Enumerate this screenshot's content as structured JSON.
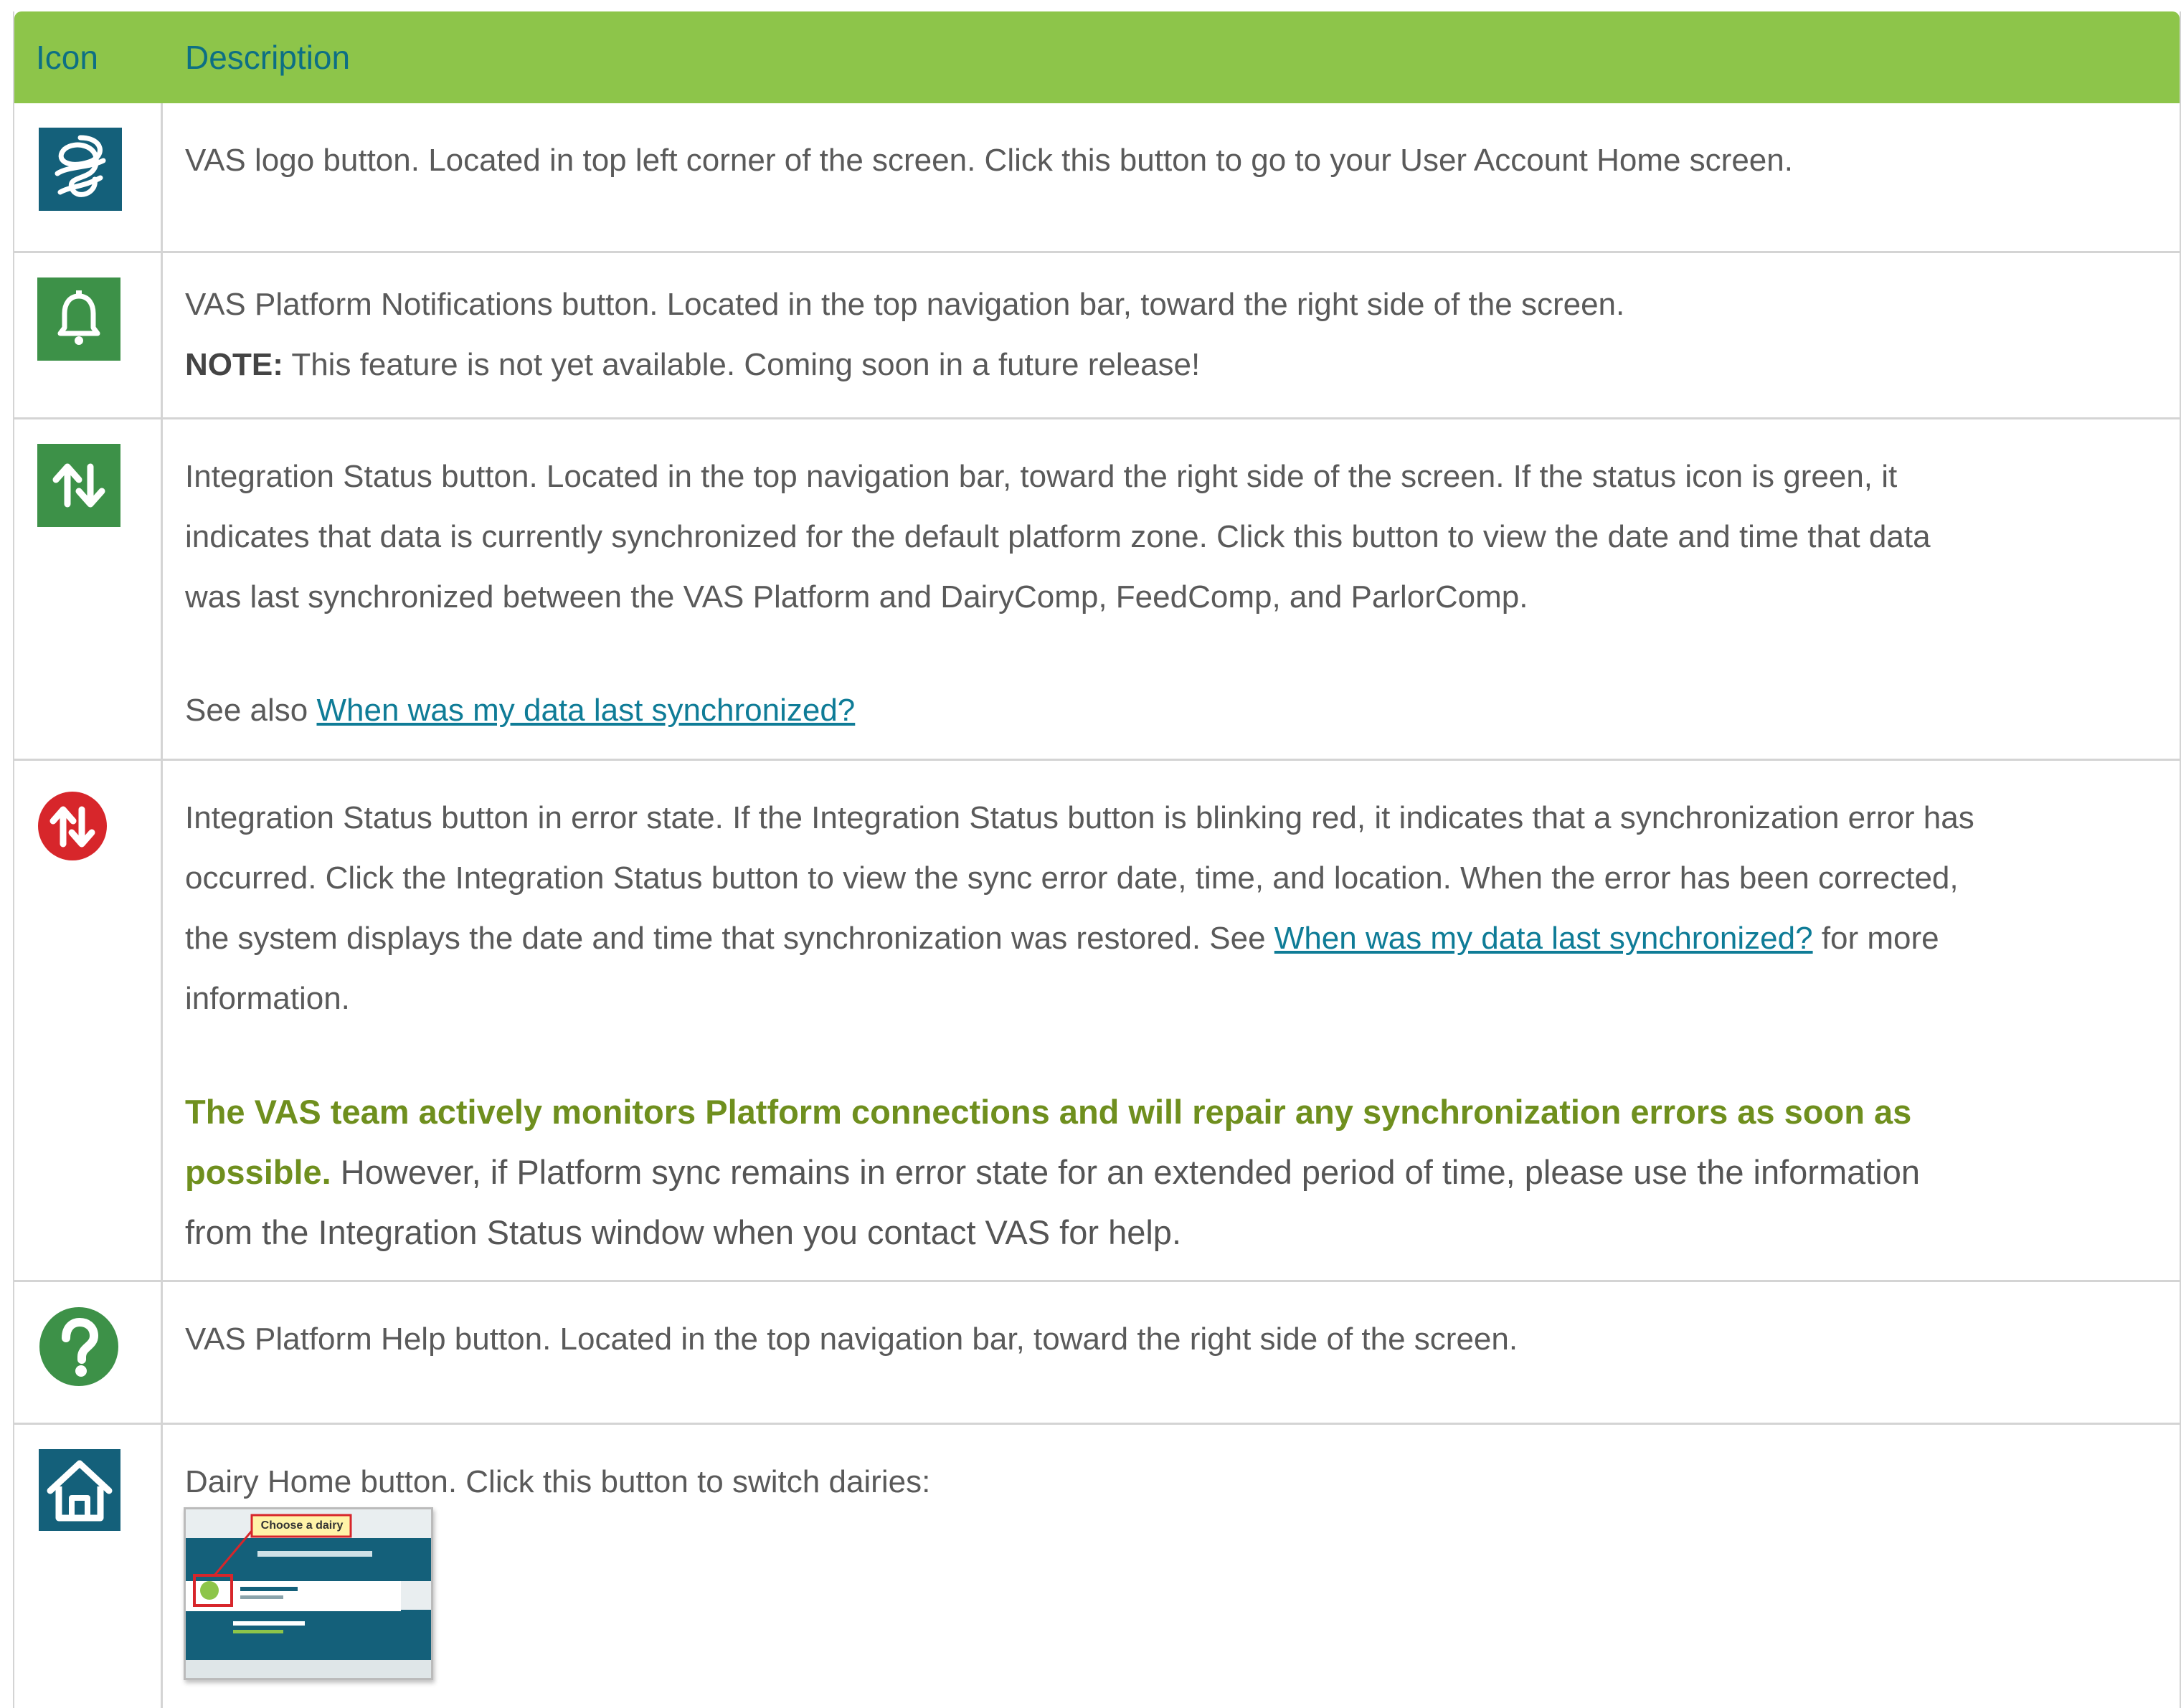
{
  "table": {
    "header": {
      "icon": "Icon",
      "description": "Description"
    },
    "rows": [
      {
        "icon": "vas-logo-icon",
        "lines": [
          "VAS logo button. Located in top left corner of the screen. Click this button to go to your User Account Home screen."
        ]
      },
      {
        "icon": "bell-icon",
        "lines": [
          "VAS Platform Notifications button. Located in the top navigation bar, toward the right side of the screen."
        ],
        "note_label": "NOTE:",
        "note_text": " This feature is not yet available. Coming soon in a future release!"
      },
      {
        "icon": "sync-arrows-icon",
        "lines": [
          "Integration Status button. Located in the top navigation bar, toward the right side of the screen. If the status icon is green, it",
          "indicates that data is currently synchronized for the default platform zone. Click this button to view the date and time that data",
          "was last synchronized between the VAS Platform and DairyComp, FeedComp, and ParlorComp."
        ],
        "see_also_prefix": "See also ",
        "see_also_link": "When was my data last synchronized?"
      },
      {
        "icon": "sync-error-icon",
        "lines": [
          "Integration Status button in error state. If the Integration Status button is blinking red, it indicates that a synchronization error has",
          "occurred. Click the Integration Status button to view the sync error date, time, and location. When the error has been corrected,"
        ],
        "line3_prefix": "the system displays the date and time that synchronization was restored. See ",
        "line3_link": "When was my data last synchronized?",
        "line3_suffix": " for more",
        "line4": "information.",
        "bold_line1": "The VAS team actively monitors Platform connections and will repair any synchronization errors as soon as",
        "bold_line2": "possible.",
        "after_bold_line2": " However, if Platform sync remains in error state for an extended period of time, please use the information",
        "after_line3": "from the Integration Status window when you contact VAS for help."
      },
      {
        "icon": "help-icon",
        "lines": [
          "VAS Platform Help button. Located in the top navigation bar, toward the right side of the screen."
        ]
      },
      {
        "icon": "home-icon",
        "lines": [
          "Dairy Home button. Click this button to switch dairies:"
        ],
        "thumbnail": {
          "callout": "Choose a dairy"
        }
      }
    ]
  },
  "colors": {
    "header_bg": "#8dc54a",
    "header_text": "#0d6f84",
    "link": "#0f7c97",
    "highlight_green": "#6f8f1e",
    "icon_blue": "#14607a",
    "icon_green": "#3d9148",
    "icon_red": "#d7262b"
  }
}
